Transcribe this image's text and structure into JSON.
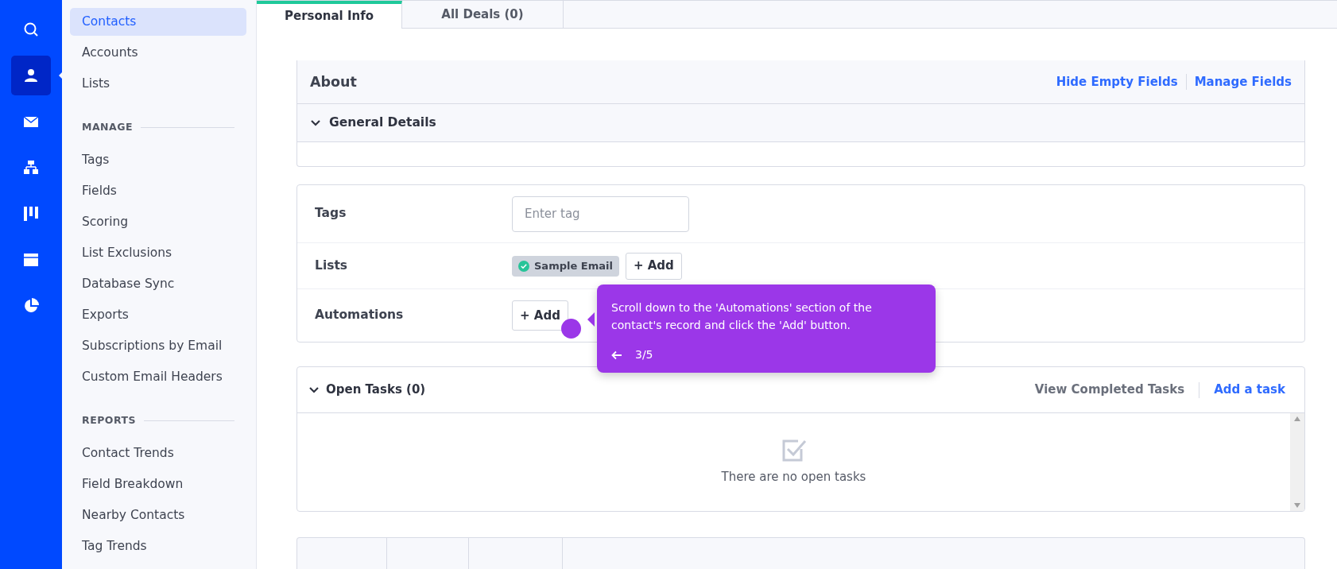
{
  "rail": [
    {
      "kind": "search",
      "selected": false
    },
    {
      "kind": "person",
      "selected": true
    },
    {
      "kind": "mail",
      "selected": false
    },
    {
      "kind": "sitemap",
      "selected": false
    },
    {
      "kind": "board",
      "selected": false
    },
    {
      "kind": "window",
      "selected": false
    },
    {
      "kind": "pie",
      "selected": false
    }
  ],
  "sidebar": {
    "sections": [
      {
        "items": [
          {
            "label": "Contacts",
            "selected": true
          },
          {
            "label": "Accounts",
            "selected": false
          },
          {
            "label": "Lists",
            "selected": false
          }
        ]
      },
      {
        "heading": "MANAGE",
        "items": [
          {
            "label": "Tags",
            "selected": false
          },
          {
            "label": "Fields",
            "selected": false
          },
          {
            "label": "Scoring",
            "selected": false
          },
          {
            "label": "List Exclusions",
            "selected": false
          },
          {
            "label": "Database Sync",
            "selected": false
          },
          {
            "label": "Exports",
            "selected": false
          },
          {
            "label": "Subscriptions by Email",
            "selected": false
          },
          {
            "label": "Custom Email Headers",
            "selected": false
          }
        ]
      },
      {
        "heading": "REPORTS",
        "items": [
          {
            "label": "Contact Trends",
            "selected": false
          },
          {
            "label": "Field Breakdown",
            "selected": false
          },
          {
            "label": "Nearby Contacts",
            "selected": false
          },
          {
            "label": "Tag Trends",
            "selected": false
          }
        ]
      }
    ]
  },
  "tabs": [
    {
      "label": "Personal Info",
      "selected": true
    },
    {
      "label": "All Deals (0)",
      "selected": false
    }
  ],
  "about": {
    "title": "About",
    "links": [
      "Hide Empty Fields",
      "Manage Fields"
    ],
    "section": {
      "title": "General Details",
      "expanded": true
    }
  },
  "fields": [
    {
      "label": "Tags",
      "kind": "input",
      "placeholder": "Enter tag"
    },
    {
      "label": "Lists",
      "kind": "tags",
      "tags": [
        {
          "label": "Sample Email",
          "color": "#27c499"
        }
      ],
      "button": "+ Add"
    },
    {
      "label": "Automations",
      "kind": "button",
      "button": "+ Add"
    }
  ],
  "tasks": {
    "title": "Open Tasks (0)",
    "expanded": true,
    "links": [
      {
        "label": "View Completed Tasks",
        "kind": "muted"
      },
      {
        "label": "Add a task",
        "kind": "primary"
      }
    ],
    "empty_text": "There are no open tasks"
  },
  "tooltip": {
    "text": "Scroll down to the 'Automations' section of the contact's record and click the 'Add' button.",
    "step": "3/5"
  }
}
